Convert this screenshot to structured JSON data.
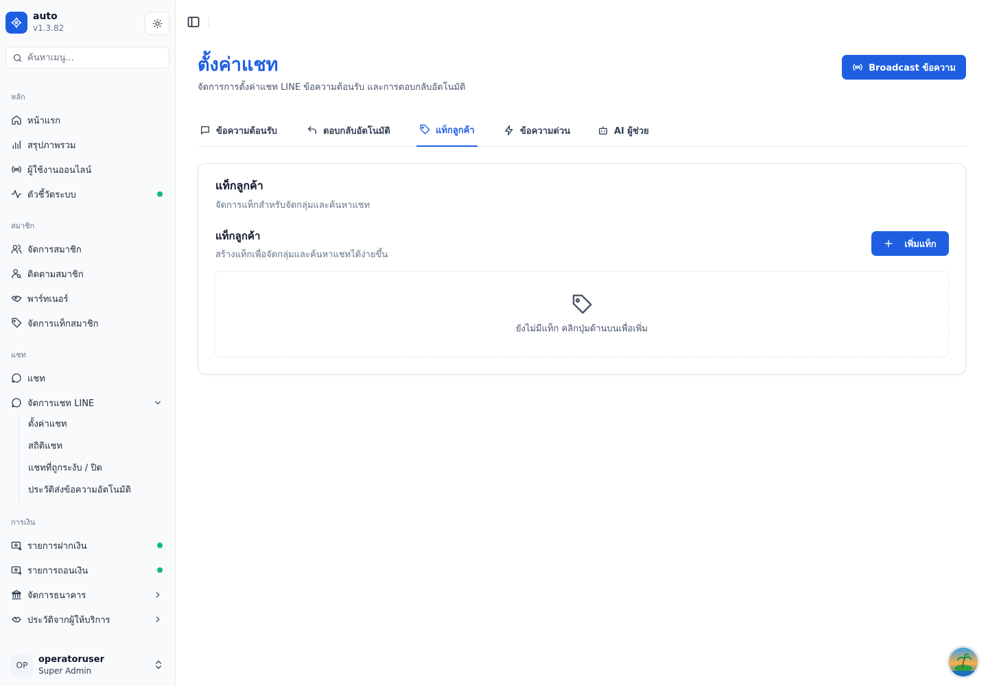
{
  "app": {
    "name": "auto",
    "version": "v1.3.82"
  },
  "search": {
    "placeholder": "ค้นหาเมนู..."
  },
  "sidebar": {
    "groups": [
      {
        "label": "หลัก",
        "items": [
          {
            "label": "หน้าแรก",
            "icon": "home-icon"
          },
          {
            "label": "สรุปภาพรวม",
            "icon": "chart-bar-icon"
          },
          {
            "label": "ผู้ใช้งานออนไลน์",
            "icon": "broadcast-icon"
          },
          {
            "label": "ตัวชี้วัดระบบ",
            "icon": "activity-icon",
            "status_dot": true
          }
        ]
      },
      {
        "label": "สมาชิก",
        "items": [
          {
            "label": "จัดการสมาชิก",
            "icon": "users-icon"
          },
          {
            "label": "ติดตามสมาชิก",
            "icon": "user-search-icon"
          },
          {
            "label": "พาร์ทเนอร์",
            "icon": "handshake-icon"
          },
          {
            "label": "จัดการแท็กสมาชิก",
            "icon": "tag-icon"
          }
        ]
      },
      {
        "label": "แชท",
        "items": [
          {
            "label": "แชท",
            "icon": "chat-icon"
          },
          {
            "label": "จัดการแชท LINE",
            "icon": "chat-icon",
            "expanded": true
          }
        ]
      },
      {
        "label": "การเงิน",
        "items": [
          {
            "label": "รายการฝากเงิน",
            "icon": "deposit-icon",
            "status_dot": true
          },
          {
            "label": "รายการถอนเงิน",
            "icon": "withdraw-icon",
            "status_dot": true
          },
          {
            "label": "จัดการธนาคาร",
            "icon": "bank-icon"
          },
          {
            "label": "ประวัติจากผู้ให้บริการ",
            "icon": "provider-icon"
          }
        ]
      }
    ],
    "line_submenu": [
      "ตั้งค่าแชท",
      "สถิติแชท",
      "แชทที่ถูกระงับ / ปิด",
      "ประวัติส่งข้อความอัตโนมัติ"
    ],
    "status_color": "#10b981"
  },
  "user": {
    "initials": "OP",
    "name": "operatoruser",
    "role": "Super Admin"
  },
  "header": {
    "title": "ตั้งค่าแชท",
    "subtitle": "จัดการการตั้งค่าแชท LINE ข้อความต้อนรับ และการตอบกลับอัตโนมัติ",
    "broadcast_label": "Broadcast ข้อความ"
  },
  "tabs": [
    {
      "label": "ข้อความต้อนรับ",
      "icon": "message-square-icon"
    },
    {
      "label": "ตอบกลับอัตโนมัติ",
      "icon": "reply-icon"
    },
    {
      "label": "แท็กลูกค้า",
      "icon": "tag-icon",
      "active": true
    },
    {
      "label": "ข้อความด่วน",
      "icon": "zap-icon"
    },
    {
      "label": "AI ผู้ช่วย",
      "icon": "bot-icon"
    }
  ],
  "card": {
    "title": "แท็กลูกค้า",
    "description": "จัดการแท็กสำหรับจัดกลุ่มและค้นหาแชท",
    "section_title": "แท็กลูกค้า",
    "section_description": "สร้างแท็กเพื่อจัดกลุ่มและค้นหาแชทได้ง่ายขึ้น",
    "add_label": "เพิ่มแท็ก",
    "empty_text": "ยังไม่มีแท็ก คลิกปุ่มด้านบนเพื่อเพิ่ม"
  },
  "colors": {
    "accent": "#1d5fe0",
    "status": "#10b981"
  }
}
